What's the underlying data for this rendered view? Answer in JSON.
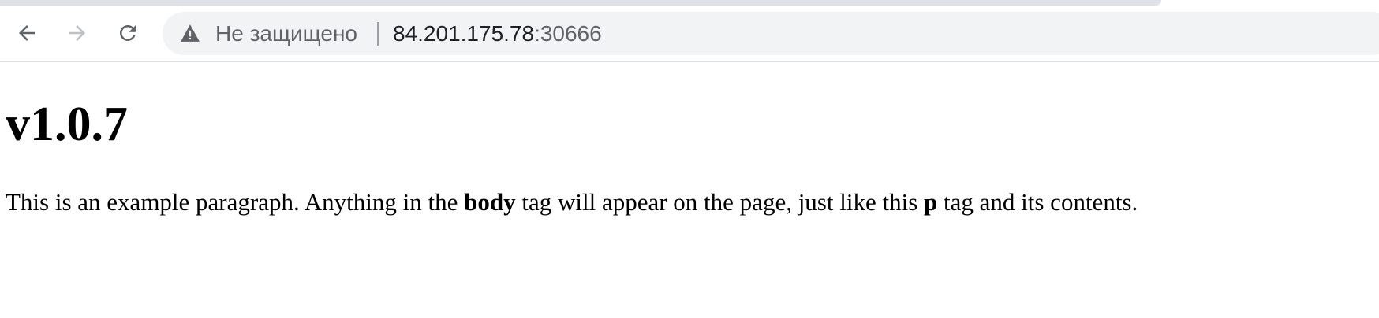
{
  "browser": {
    "tab_strip_color": "#dee1e6",
    "nav": {
      "back_icon": "arrow-left-icon",
      "forward_icon": "arrow-right-icon",
      "reload_icon": "reload-icon",
      "forward_disabled": true
    },
    "omnibox": {
      "security_icon": "warning-triangle-icon",
      "security_label": "Не защищено",
      "url_host": "84.201.175.78",
      "url_port": ":30666"
    }
  },
  "page": {
    "heading": "v1.0.7",
    "paragraph": {
      "part1": "This is an example paragraph. Anything in the ",
      "bold1": "body",
      "part2": " tag will appear on the page, just like this ",
      "bold2": "p",
      "part3": " tag and its contents."
    }
  }
}
